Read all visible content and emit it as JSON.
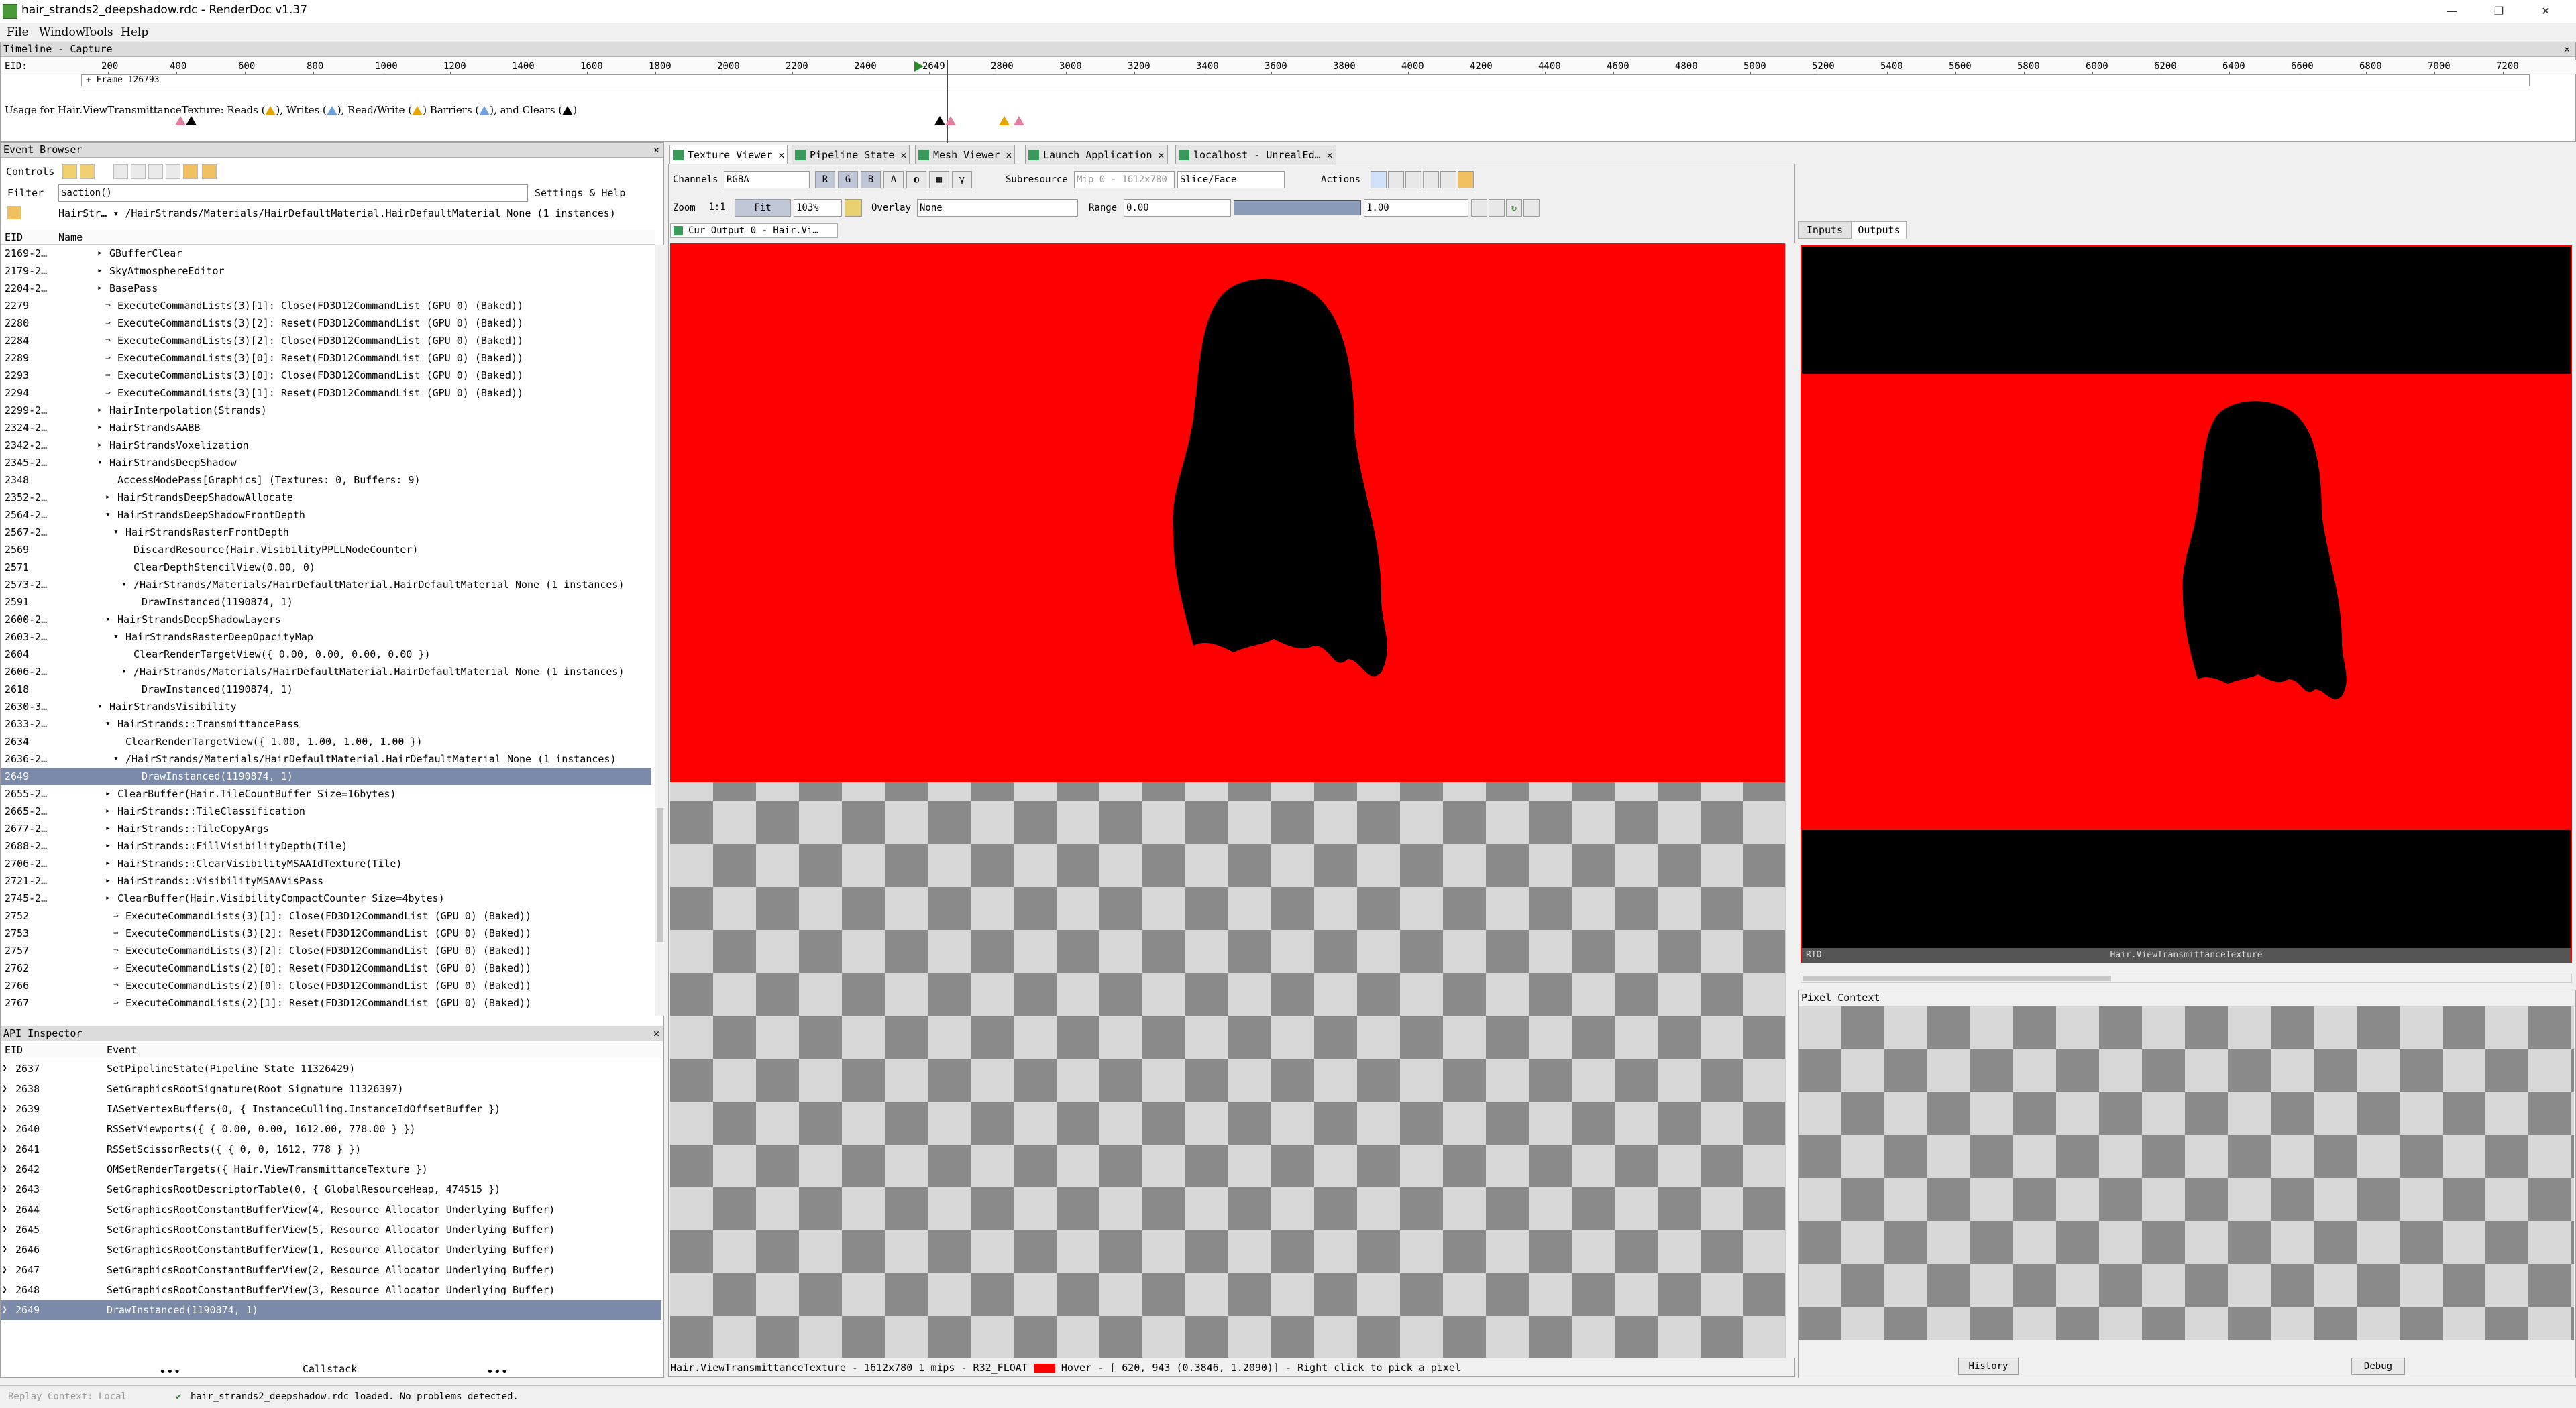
{
  "window": {
    "title": "hair_strands2_deepshadow.rdc - RenderDoc v1.37"
  },
  "menu": [
    "File",
    "Window",
    "Tools",
    "Help"
  ],
  "timeline": {
    "header": "Timeline - Capture",
    "eid_label": "EID:",
    "ticks": [
      "200",
      "400",
      "600",
      "800",
      "1000",
      "1200",
      "1400",
      "1600",
      "1800",
      "2000",
      "2200",
      "2400",
      "2649",
      "2800",
      "3000",
      "3200",
      "3400",
      "3600",
      "3800",
      "4000",
      "4200",
      "4400",
      "4600",
      "4800",
      "5000",
      "5200",
      "5400",
      "5600",
      "5800",
      "6000",
      "6200",
      "6400",
      "6600",
      "6800",
      "7000",
      "7200"
    ],
    "frame_label": "+ Frame 126793",
    "usage_prefix": "Usage for Hair.ViewTransmittanceTexture: Reads (",
    "usage_writes": "), Writes (",
    "usage_rw": "), Read/Write (",
    "usage_barriers": ") Barriers (",
    "usage_clears": "), and Clears (",
    "usage_end": ")"
  },
  "event_browser": {
    "header": "Event Browser",
    "controls_label": "Controls",
    "filter_label": "Filter",
    "filter_value": "$action()",
    "settings_label": "Settings & Help",
    "breadcrumb": "HairStr…  ▾  /HairStrands/Materials/HairDefaultMaterial.HairDefaultMaterial None (1 instances)",
    "col_eid": "EID",
    "col_name": "Name",
    "rows": [
      {
        "eid": "2169-2…",
        "indent": 1,
        "arrow": "▸",
        "name": "GBufferClear"
      },
      {
        "eid": "2179-2…",
        "indent": 1,
        "arrow": "▸",
        "name": "SkyAtmosphereEditor"
      },
      {
        "eid": "2204-2…",
        "indent": 1,
        "arrow": "▸",
        "name": "BasePass"
      },
      {
        "eid": "2279",
        "indent": 2,
        "arrow": "⇒",
        "name": "ExecuteCommandLists(3)[1]:  Close(FD3D12CommandList (GPU 0) (Baked))"
      },
      {
        "eid": "2280",
        "indent": 2,
        "arrow": "⇒",
        "name": "ExecuteCommandLists(3)[2]:  Reset(FD3D12CommandList (GPU 0) (Baked))"
      },
      {
        "eid": "2284",
        "indent": 2,
        "arrow": "⇒",
        "name": "ExecuteCommandLists(3)[2]:  Close(FD3D12CommandList (GPU 0) (Baked))"
      },
      {
        "eid": "2289",
        "indent": 2,
        "arrow": "⇒",
        "name": "ExecuteCommandLists(3)[0]:  Reset(FD3D12CommandList (GPU 0) (Baked))"
      },
      {
        "eid": "2293",
        "indent": 2,
        "arrow": "⇒",
        "name": "ExecuteCommandLists(3)[0]:  Close(FD3D12CommandList (GPU 0) (Baked))"
      },
      {
        "eid": "2294",
        "indent": 2,
        "arrow": "⇒",
        "name": "ExecuteCommandLists(3)[1]:  Reset(FD3D12CommandList (GPU 0) (Baked))"
      },
      {
        "eid": "2299-2…",
        "indent": 1,
        "arrow": "▸",
        "name": "HairInterpolation(Strands)"
      },
      {
        "eid": "2324-2…",
        "indent": 1,
        "arrow": "▸",
        "name": "HairStrandsAABB"
      },
      {
        "eid": "2342-2…",
        "indent": 1,
        "arrow": "▸",
        "name": "HairStrandsVoxelization"
      },
      {
        "eid": "2345-2…",
        "indent": 1,
        "arrow": "▾",
        "name": "HairStrandsDeepShadow"
      },
      {
        "eid": "2348",
        "indent": 2,
        "arrow": "",
        "name": "AccessModePass[Graphics] (Textures: 0, Buffers: 9)"
      },
      {
        "eid": "2352-2…",
        "indent": 2,
        "arrow": "▸",
        "name": "HairStrandsDeepShadowAllocate"
      },
      {
        "eid": "2564-2…",
        "indent": 2,
        "arrow": "▾",
        "name": "HairStrandsDeepShadowFrontDepth"
      },
      {
        "eid": "2567-2…",
        "indent": 3,
        "arrow": "▾",
        "name": "HairStrandsRasterFrontDepth"
      },
      {
        "eid": "2569",
        "indent": 4,
        "arrow": "",
        "name": "DiscardResource(Hair.VisibilityPPLLNodeCounter)"
      },
      {
        "eid": "2571",
        "indent": 4,
        "arrow": "",
        "name": "ClearDepthStencilView(0.00, 0)"
      },
      {
        "eid": "2573-2…",
        "indent": 4,
        "arrow": "▾",
        "name": "/HairStrands/Materials/HairDefaultMaterial.HairDefaultMaterial None (1 instances)"
      },
      {
        "eid": "2591",
        "indent": 5,
        "arrow": "",
        "name": "DrawInstanced(1190874, 1)"
      },
      {
        "eid": "2600-2…",
        "indent": 2,
        "arrow": "▾",
        "name": "HairStrandsDeepShadowLayers"
      },
      {
        "eid": "2603-2…",
        "indent": 3,
        "arrow": "▾",
        "name": "HairStrandsRasterDeepOpacityMap"
      },
      {
        "eid": "2604",
        "indent": 4,
        "arrow": "",
        "name": "ClearRenderTargetView({ 0.00, 0.00, 0.00, 0.00 })"
      },
      {
        "eid": "2606-2…",
        "indent": 4,
        "arrow": "▾",
        "name": "/HairStrands/Materials/HairDefaultMaterial.HairDefaultMaterial None (1 instances)"
      },
      {
        "eid": "2618",
        "indent": 5,
        "arrow": "",
        "name": "DrawInstanced(1190874, 1)"
      },
      {
        "eid": "2630-3…",
        "indent": 1,
        "arrow": "▾",
        "name": "HairStrandsVisibility"
      },
      {
        "eid": "2633-2…",
        "indent": 2,
        "arrow": "▾",
        "name": "HairStrands::TransmittancePass"
      },
      {
        "eid": "2634",
        "indent": 3,
        "arrow": "",
        "name": "ClearRenderTargetView({ 1.00, 1.00, 1.00, 1.00 })"
      },
      {
        "eid": "2636-2…",
        "indent": 3,
        "arrow": "▾",
        "name": "/HairStrands/Materials/HairDefaultMaterial.HairDefaultMaterial None (1 instances)"
      },
      {
        "eid": "2649",
        "indent": 5,
        "arrow": "",
        "name": "DrawInstanced(1190874, 1)",
        "selected": true
      },
      {
        "eid": "2655-2…",
        "indent": 2,
        "arrow": "▸",
        "name": "ClearBuffer(Hair.TileCountBuffer Size=16bytes)"
      },
      {
        "eid": "2665-2…",
        "indent": 2,
        "arrow": "▸",
        "name": "HairStrands::TileClassification"
      },
      {
        "eid": "2677-2…",
        "indent": 2,
        "arrow": "▸",
        "name": "HairStrands::TileCopyArgs"
      },
      {
        "eid": "2688-2…",
        "indent": 2,
        "arrow": "▸",
        "name": "HairStrands::FillVisibilityDepth(Tile)"
      },
      {
        "eid": "2706-2…",
        "indent": 2,
        "arrow": "▸",
        "name": "HairStrands::ClearVisibilityMSAAIdTexture(Tile)"
      },
      {
        "eid": "2721-2…",
        "indent": 2,
        "arrow": "▸",
        "name": "HairStrands::VisibilityMSAAVisPass"
      },
      {
        "eid": "2745-2…",
        "indent": 2,
        "arrow": "▸",
        "name": "ClearBuffer(Hair.VisibilityCompactCounter Size=4bytes)"
      },
      {
        "eid": "2752",
        "indent": 3,
        "arrow": "⇒",
        "name": "ExecuteCommandLists(3)[1]:  Close(FD3D12CommandList (GPU 0) (Baked))"
      },
      {
        "eid": "2753",
        "indent": 3,
        "arrow": "⇒",
        "name": "ExecuteCommandLists(3)[2]:  Reset(FD3D12CommandList (GPU 0) (Baked))"
      },
      {
        "eid": "2757",
        "indent": 3,
        "arrow": "⇒",
        "name": "ExecuteCommandLists(3)[2]:  Close(FD3D12CommandList (GPU 0) (Baked))"
      },
      {
        "eid": "2762",
        "indent": 3,
        "arrow": "⇒",
        "name": "ExecuteCommandLists(2)[0]:  Reset(FD3D12CommandList (GPU 0) (Baked))"
      },
      {
        "eid": "2766",
        "indent": 3,
        "arrow": "⇒",
        "name": "ExecuteCommandLists(2)[0]:  Close(FD3D12CommandList (GPU 0) (Baked))"
      },
      {
        "eid": "2767",
        "indent": 3,
        "arrow": "⇒",
        "name": "ExecuteCommandLists(2)[1]:  Reset(FD3D12CommandList (GPU 0) (Baked))"
      }
    ]
  },
  "api_inspector": {
    "header": "API Inspector",
    "col_eid": "EID",
    "col_event": "Event",
    "rows": [
      {
        "eid": "2637",
        "event": "SetPipelineState(Pipeline State 11326429)"
      },
      {
        "eid": "2638",
        "event": "SetGraphicsRootSignature(Root Signature 11326397)"
      },
      {
        "eid": "2639",
        "event": "IASetVertexBuffers(0,  {  InstanceCulling.InstanceIdOffsetBuffer  })"
      },
      {
        "eid": "2640",
        "event": "RSSetViewports({ { 0.00, 0.00, 1612.00, 778.00 } })"
      },
      {
        "eid": "2641",
        "event": "RSSetScissorRects({ { 0, 0, 1612, 778 } })"
      },
      {
        "eid": "2642",
        "event": "OMSetRenderTargets({  Hair.ViewTransmittanceTexture  })"
      },
      {
        "eid": "2643",
        "event": "SetGraphicsRootDescriptorTable(0,  {  GlobalResourceHeap,  474515  })"
      },
      {
        "eid": "2644",
        "event": "SetGraphicsRootConstantBufferView(4,  Resource Allocator Underlying Buffer)"
      },
      {
        "eid": "2645",
        "event": "SetGraphicsRootConstantBufferView(5,  Resource Allocator Underlying Buffer)"
      },
      {
        "eid": "2646",
        "event": "SetGraphicsRootConstantBufferView(1,  Resource Allocator Underlying Buffer)"
      },
      {
        "eid": "2647",
        "event": "SetGraphicsRootConstantBufferView(2,  Resource Allocator Underlying Buffer)"
      },
      {
        "eid": "2648",
        "event": "SetGraphicsRootConstantBufferView(3,  Resource Allocator Underlying Buffer)"
      },
      {
        "eid": "2649",
        "event": "DrawInstanced(1190874, 1)",
        "selected": true
      }
    ],
    "callstack_label": "Callstack",
    "dots": "•••"
  },
  "tabs": [
    {
      "label": "Texture Viewer",
      "active": true
    },
    {
      "label": "Pipeline State",
      "active": false
    },
    {
      "label": "Mesh Viewer",
      "active": false
    },
    {
      "label": "Launch Application",
      "active": false
    },
    {
      "label": "localhost - UnrealEd…",
      "active": false
    }
  ],
  "texture_viewer": {
    "channels_label": "Channels",
    "channels_value": "RGBA",
    "channel_r": "R",
    "channel_g": "G",
    "channel_b": "B",
    "channel_a": "A",
    "subresource_label": "Subresource",
    "mip_value": "Mip 0 - 1612x780",
    "slice_value": "Slice/Face",
    "actions_label": "Actions",
    "zoom_label": "Zoom",
    "zoom_11": "1:1",
    "fit_label": "Fit",
    "zoom_value": "103%",
    "overlay_label": "Overlay",
    "overlay_value": "None",
    "range_label": "Range",
    "range_min": "0.00",
    "range_max": "1.00",
    "output_tab": "Cur Output 0 - Hair.Vi…",
    "status": "Hair.ViewTransmittanceTexture - 1612x780 1 mips - R32_FLOAT",
    "hover": "Hover - [ 620,  943 (0.3846, 1.2090)] - Right click to pick a pixel"
  },
  "thumbs": {
    "inputs_tab": "Inputs",
    "outputs_tab": "Outputs",
    "eid_label": "RTO",
    "thumb_label": "Hair.ViewTransmittanceTexture",
    "pixel_context": "Pixel Context",
    "history_btn": "History",
    "debug_btn": "Debug"
  },
  "statusbar": {
    "replay": "Replay Context: Local",
    "message": "hair_strands2_deepshadow.rdc loaded. No problems detected."
  },
  "colors": {
    "red": "#ff0000",
    "select": "#7a8aa8",
    "panel": "#f0f0f0"
  }
}
